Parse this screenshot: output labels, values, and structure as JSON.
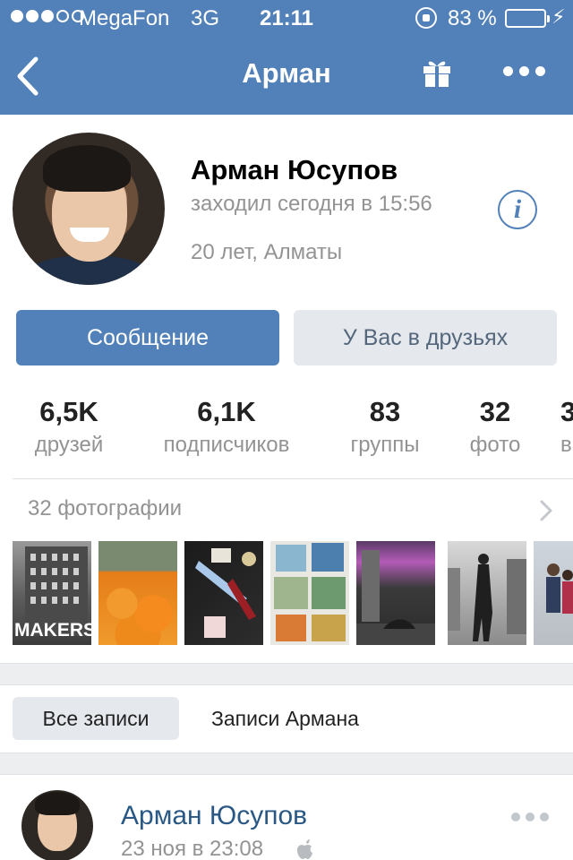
{
  "status_bar": {
    "carrier": "MegaFon",
    "network": "3G",
    "time": "21:11",
    "battery_percent": "83 %",
    "battery_level": 0.83,
    "signal_bars_filled": 3,
    "signal_bars_total": 5
  },
  "nav": {
    "title": "Арман",
    "back_icon": "chevron-left-icon",
    "gift_icon": "gift-icon",
    "more_icon": "more-horizontal-icon"
  },
  "profile": {
    "name": "Арман Юсупов",
    "last_seen": "заходил сегодня в 15:56",
    "age_city": "20 лет, Алматы",
    "info_icon_glyph": "i"
  },
  "actions": {
    "message_label": "Сообщение",
    "friends_label": "У Вас в друзьях"
  },
  "counters": [
    {
      "value": "6,5K",
      "label": "друзей"
    },
    {
      "value": "6,1K",
      "label": "подписчиков"
    },
    {
      "value": "83",
      "label": "группы"
    },
    {
      "value": "32",
      "label": "фото"
    },
    {
      "value": "3",
      "label": "в"
    }
  ],
  "photos": {
    "header": "32 фотографии",
    "thumb_text_makers": "MAKERS"
  },
  "wall_tabs": {
    "all_posts": "Все записи",
    "owner_posts": "Записи Армана"
  },
  "post": {
    "author": "Арман Юсупов",
    "date": "23 ноя в 23:08"
  },
  "colors": {
    "brand_blue": "#5181b8",
    "link_blue": "#2a5885",
    "secondary_button": "#e5e8ec",
    "battery_green": "#4cd964",
    "muted_text": "#939393"
  }
}
